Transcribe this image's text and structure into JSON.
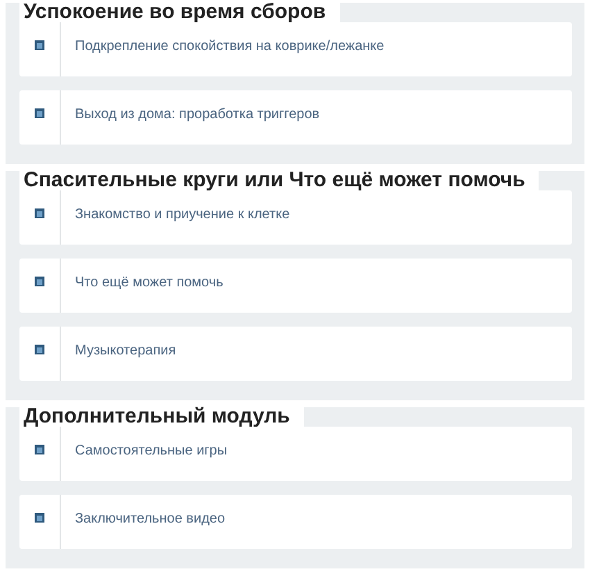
{
  "sections": [
    {
      "title": "Успокоение во время сборов",
      "lessons": [
        {
          "title": "Подкрепление спокойствия на коврике/лежанке"
        },
        {
          "title": "Выход из дома: проработка триггеров"
        }
      ]
    },
    {
      "title": "Спасительные круги или Что ещё может помочь",
      "lessons": [
        {
          "title": "Знакомство и приучение к клетке"
        },
        {
          "title": "Что ещё может помочь"
        },
        {
          "title": "Музыкотерапия"
        }
      ]
    },
    {
      "title": "Дополнительный модуль",
      "lessons": [
        {
          "title": "Самостоятельные игры"
        },
        {
          "title": "Заключительное видео"
        }
      ]
    }
  ]
}
